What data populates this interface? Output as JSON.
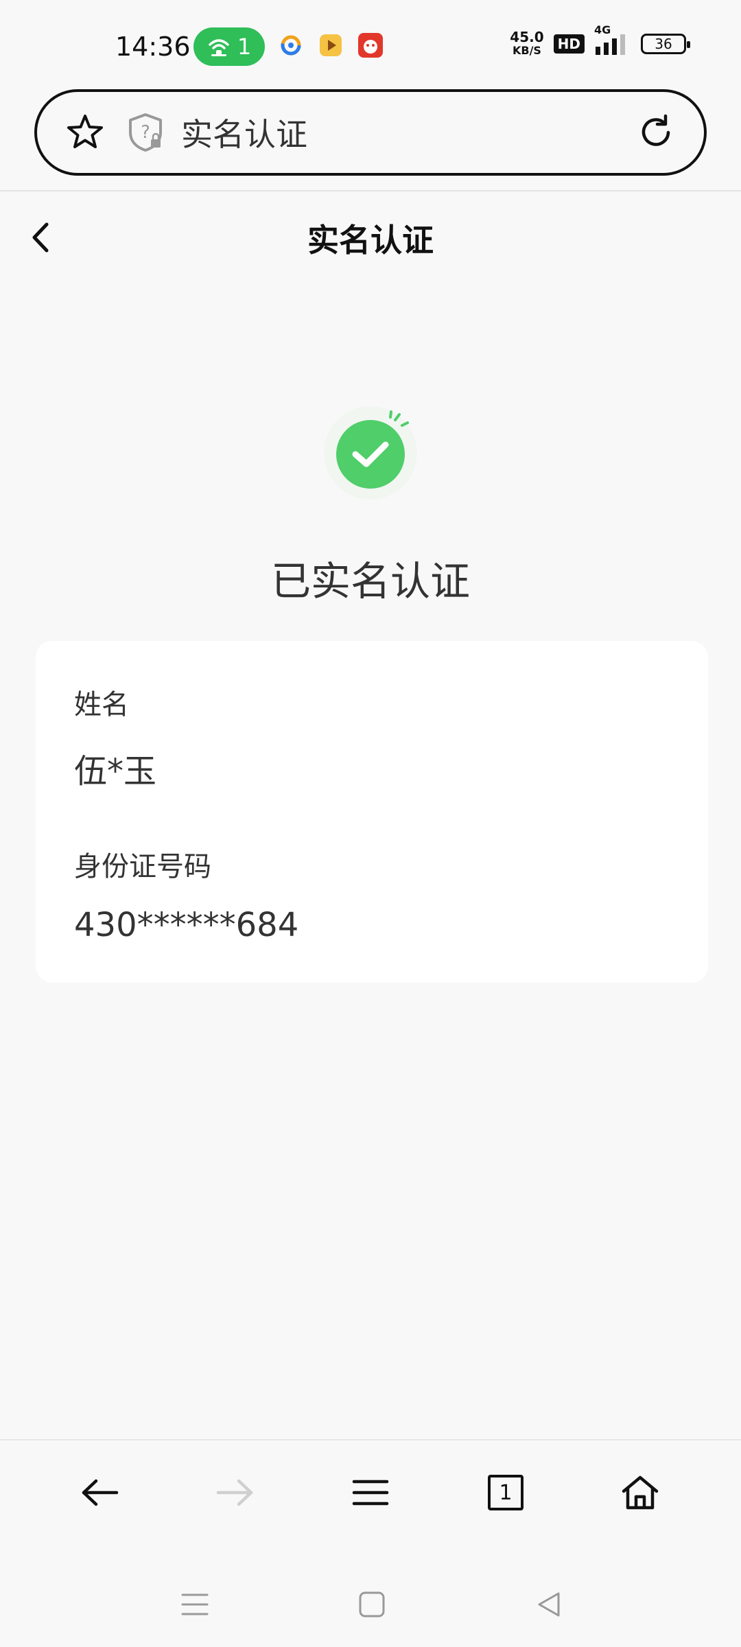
{
  "status_bar": {
    "time": "14:36",
    "hotspot_count": "1",
    "network_speed_value": "45.0",
    "network_speed_unit": "KB/S",
    "hd_label": "HD",
    "network_type": "4G",
    "battery_level": "36"
  },
  "address_bar": {
    "title": "实名认证"
  },
  "header": {
    "title": "实名认证"
  },
  "verification": {
    "status": "已实名认证",
    "name_label": "姓名",
    "name_value": "伍*玉",
    "id_label": "身份证号码",
    "id_value": "430******684"
  },
  "toolbar": {
    "tabs_count": "1"
  },
  "colors": {
    "success_green": "#4fce6a",
    "hotspot_green": "#2fbe58"
  }
}
